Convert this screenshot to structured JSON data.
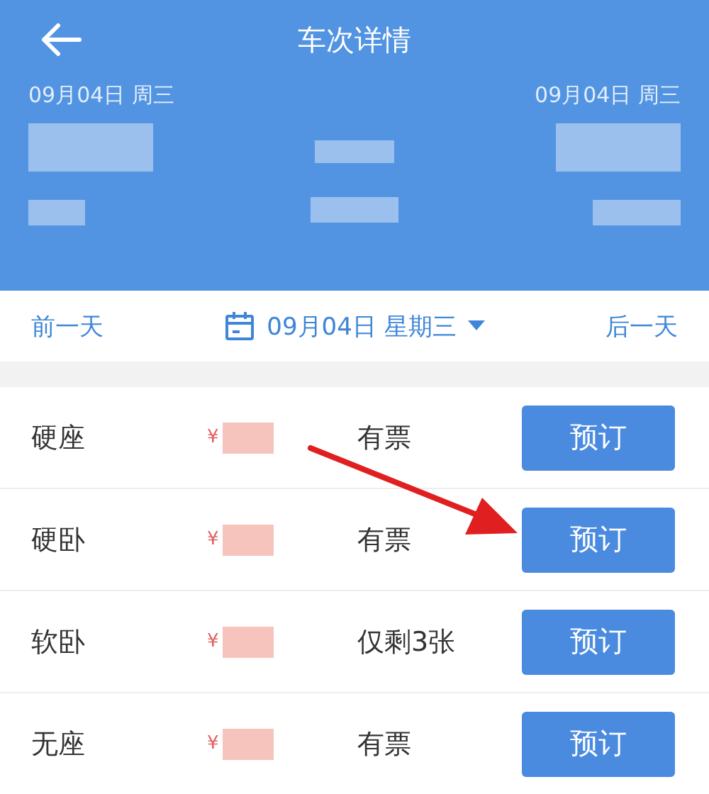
{
  "header": {
    "title": "车次详情",
    "depart_date": "09月04日 周三",
    "arrive_date": "09月04日 周三"
  },
  "date_bar": {
    "prev": "前一天",
    "date": "09月04日 星期三",
    "next": "后一天"
  },
  "seats": [
    {
      "name": "硬座",
      "currency": "¥",
      "availability": "有票",
      "button": "预订"
    },
    {
      "name": "硬卧",
      "currency": "¥",
      "availability": "有票",
      "button": "预订"
    },
    {
      "name": "软卧",
      "currency": "¥",
      "availability": "仅剩3张",
      "button": "预订"
    },
    {
      "name": "无座",
      "currency": "¥",
      "availability": "有票",
      "button": "预订"
    }
  ]
}
